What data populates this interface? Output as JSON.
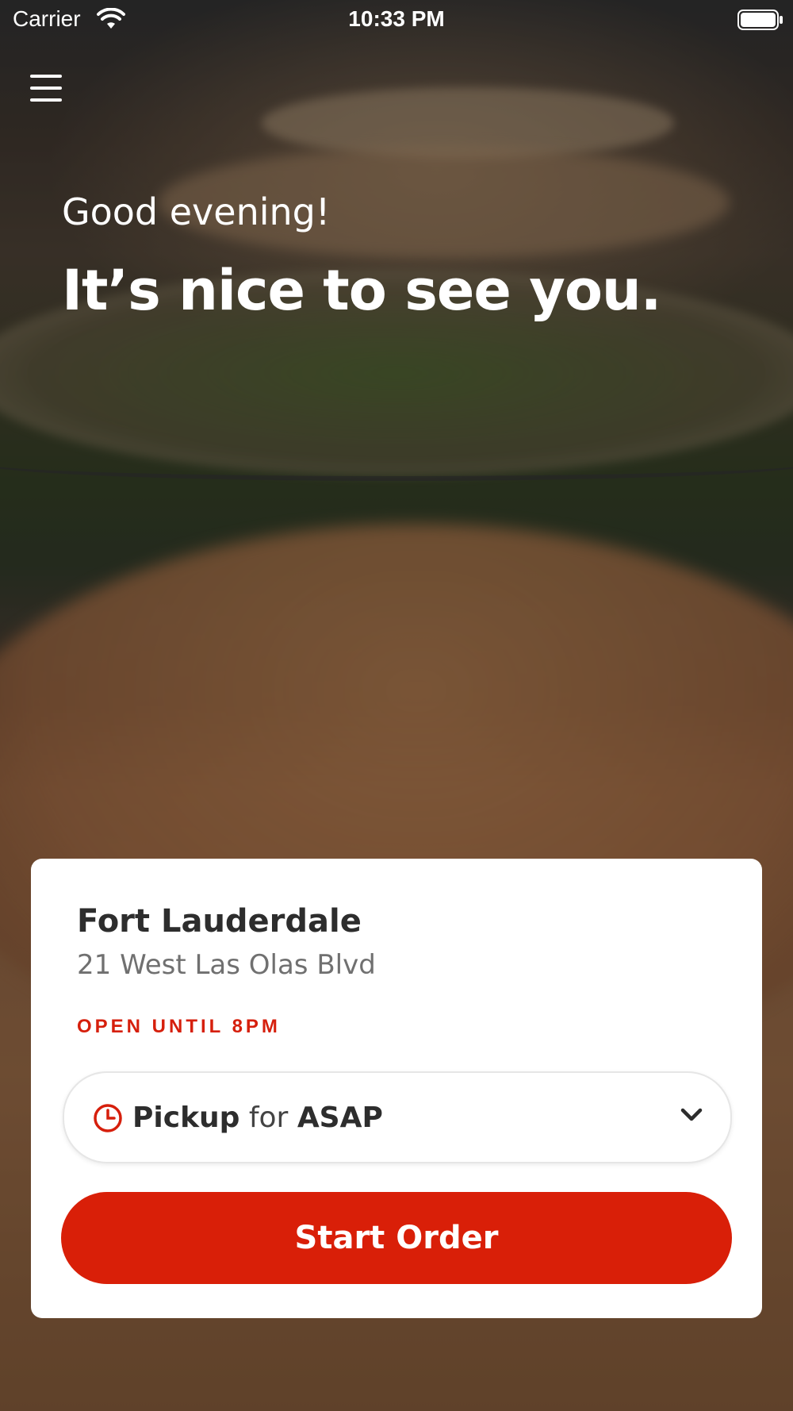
{
  "status_bar": {
    "carrier": "Carrier",
    "time": "10:33 PM",
    "wifi_icon": "wifi-icon",
    "battery_icon": "battery-icon"
  },
  "header": {
    "menu_icon": "hamburger-menu-icon"
  },
  "hero": {
    "greeting": "Good evening!",
    "headline": "It’s nice to see you."
  },
  "location_card": {
    "name": "Fort Lauderdale",
    "address": "21 West Las Olas Blvd",
    "status": "OPEN UNTIL 8PM",
    "status_color": "#d61f0c",
    "pickup_selector": {
      "icon": "clock-icon",
      "mode": "Pickup",
      "connector": "for",
      "time": "ASAP",
      "dropdown_icon": "chevron-down-icon"
    },
    "start_button": {
      "label": "Start Order",
      "color": "#d91f08"
    }
  }
}
